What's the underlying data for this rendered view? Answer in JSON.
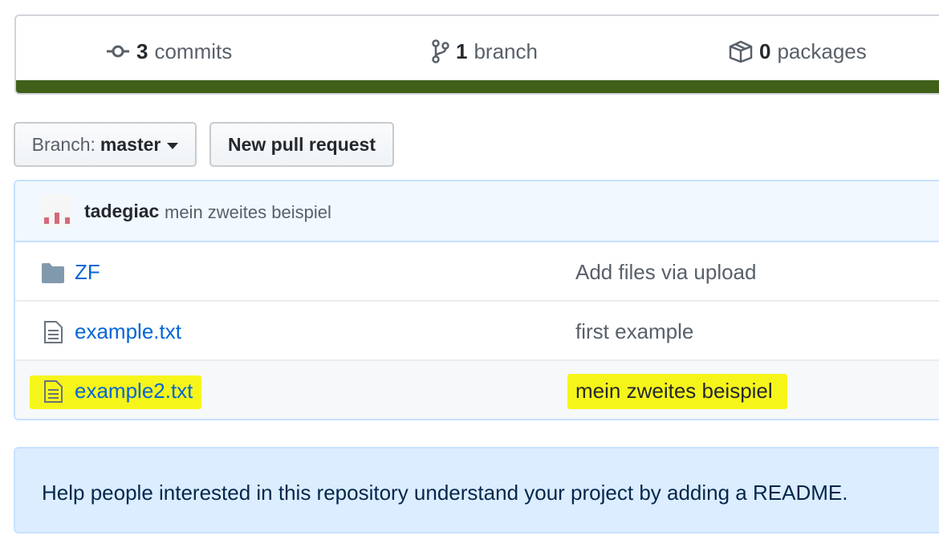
{
  "stats": {
    "commits": {
      "count": "3",
      "label": "commits",
      "icon": "commit-icon"
    },
    "branches": {
      "count": "1",
      "label": "branch",
      "icon": "branch-icon"
    },
    "packages": {
      "count": "0",
      "label": "packages",
      "icon": "package-icon"
    },
    "language_bar_color": "#40601a"
  },
  "toolbar": {
    "branch_prefix": "Branch:",
    "branch_name": "master",
    "new_pr_label": "New pull request"
  },
  "commit": {
    "author": "tadegiac",
    "message": "mein zweites beispiel"
  },
  "files": [
    {
      "type": "folder",
      "icon": "folder-icon",
      "name": "ZF",
      "message": "Add files via upload",
      "highlighted": false
    },
    {
      "type": "file",
      "icon": "file-icon",
      "name": "example.txt",
      "message": "first example",
      "highlighted": false
    },
    {
      "type": "file",
      "icon": "file-icon",
      "name": "example2.txt",
      "message": "mein zweites beispiel",
      "highlighted": true
    }
  ],
  "readme": {
    "text": "Help people interested in this repository understand your project by adding a README."
  },
  "colors": {
    "link": "#0366d6",
    "highlight": "#f6f51a",
    "readme_bg": "#dbedff"
  }
}
